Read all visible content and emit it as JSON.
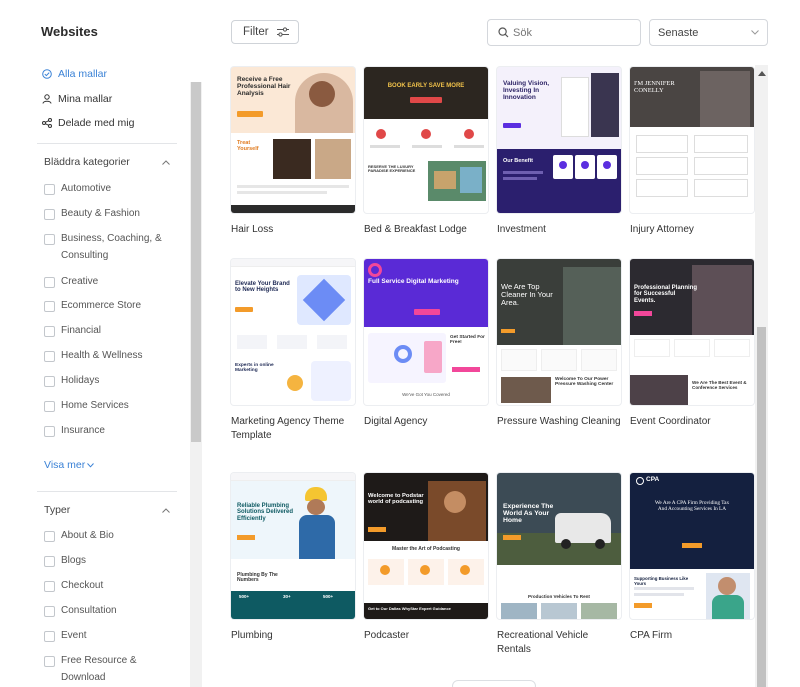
{
  "header": {
    "title": "Websites",
    "filter_label": "Filter",
    "search_placeholder": "Sök",
    "sort_value": "Senaste"
  },
  "sidebar": {
    "nav": [
      {
        "label": "Alla mallar",
        "icon": "check-circle-icon",
        "active": true
      },
      {
        "label": "Mina mallar",
        "icon": "user-icon",
        "active": false
      },
      {
        "label": "Delade med mig",
        "icon": "share-icon",
        "active": false
      }
    ],
    "categories": {
      "title": "Bläddra kategorier",
      "items": [
        "Automotive",
        "Beauty & Fashion",
        "Business, Coaching, & Consulting",
        "Creative",
        "Ecommerce Store",
        "Financial",
        "Health & Wellness",
        "Holidays",
        "Home Services",
        "Insurance"
      ],
      "show_more": "Visa mer"
    },
    "types": {
      "title": "Typer",
      "items": [
        "About & Bio",
        "Blogs",
        "Checkout",
        "Consultation",
        "Event",
        "Free Resource & Download"
      ]
    }
  },
  "templates": [
    {
      "name": "Hair Loss",
      "headline": "Receive a Free Professional Hair Analysis",
      "sub": "Treat Yourself"
    },
    {
      "name": "Bed & Breakfast Lodge",
      "headline": "BOOK EARLY SAVE MORE",
      "sub": "RESERVE THE LUXURY PARADISE EXPERIENCE"
    },
    {
      "name": "Investment",
      "headline": "Valuing Vision, Investing In Innovation",
      "sub": "Our Benefit"
    },
    {
      "name": "Injury Attorney",
      "headline": "I'M JENNIFER CONELLY",
      "sub": ""
    },
    {
      "name": "Marketing Agency Theme Template",
      "headline": "Elevate Your Brand to New Heights",
      "sub": "Experts in online Marketing"
    },
    {
      "name": "Digital Agency",
      "headline": "Full Service Digital Marketing",
      "sub": "Get Started For Free!",
      "extra": "We've Got You Covered"
    },
    {
      "name": "Pressure Washing Cleaning",
      "headline": "We Are Top Cleaner In Your Area.",
      "sub": "Welcome To Our Power Pressure Washing Center"
    },
    {
      "name": "Event Coordinator",
      "headline": "Professional Planning for Successful Events.",
      "sub": "We Are The Best Event & Conference Services"
    },
    {
      "name": "Plumbing",
      "headline": "Reliable Plumbing Solutions Delivered Efficiently",
      "sub": "Plumbing By The Numbers",
      "stats": [
        "500+",
        "30+",
        "500+"
      ]
    },
    {
      "name": "Podcaster",
      "headline": "Welcome to Podstar world of podcasting",
      "sub": "Master the Art of Podcasting",
      "extra": "Get to Our Dallas WhyStar Expert Guidance"
    },
    {
      "name": "Recreational Vehicle Rentals",
      "headline": "Experience The World As Your Home",
      "sub": "Production Vehicles To Rent"
    },
    {
      "name": "CPA Firm",
      "headline": "We Are A CPA Firm Providing Tax And Accounting Services In LA",
      "sub": "Supporting Business Like Yours",
      "brand": "CPA"
    }
  ],
  "colors": {
    "accent": "#3b82d6",
    "purple": "#5b2ee0",
    "orange": "#f39b2a"
  }
}
